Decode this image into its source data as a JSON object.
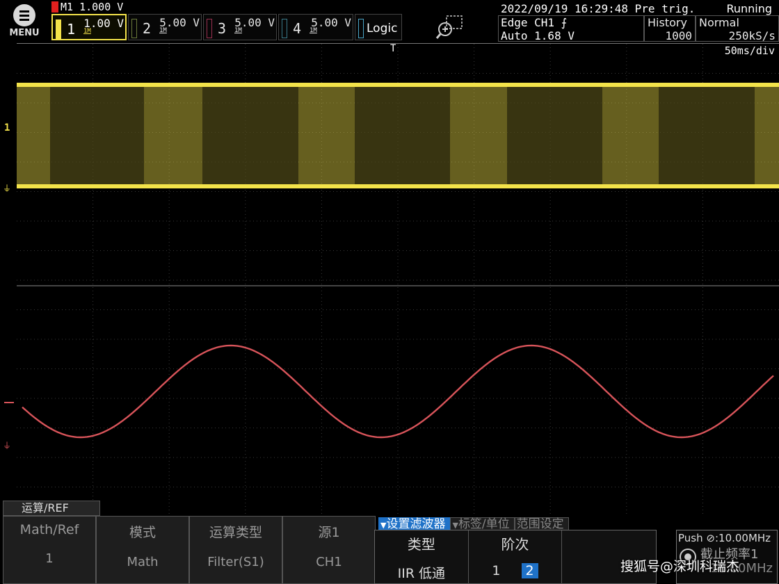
{
  "menu": {
    "label": "MENU"
  },
  "math_channel": {
    "label": "M1 1.000 V",
    "color": "#e0201e"
  },
  "channels": [
    {
      "num": "1",
      "value": "1.00 V",
      "impedance": "1M",
      "color": "#f3e34a",
      "active": true
    },
    {
      "num": "2",
      "value": "5.00 V",
      "impedance": "1M",
      "color": "#6a7a3a"
    },
    {
      "num": "3",
      "value": "5.00 V",
      "impedance": "1M",
      "color": "#9a3050"
    },
    {
      "num": "4",
      "value": "5.00 V",
      "impedance": "1M",
      "color": "#3a7a8a"
    }
  ],
  "logic": {
    "label": "Logic"
  },
  "status": {
    "datetime": "2022/09/19 16:29:48 Pre trig.",
    "run_state": "Running",
    "trigger_line1": "Edge CH1 ⨍",
    "trigger_line2": "Auto 1.68 V",
    "history_label": "History",
    "history_value": "1000",
    "mode_label": "Normal",
    "sample_rate": "250kS/s"
  },
  "display": {
    "timebase": "50ms/div",
    "trigger_marker": "T",
    "ch1_level_marker": "1",
    "ch1_color": "#f3e34a",
    "math_color": "#d8545a",
    "sine_cycles": 2.5
  },
  "bottom_menu": {
    "title": "运算/REF",
    "softkeys": [
      {
        "label": "Math/Ref",
        "value": "1"
      },
      {
        "label": "模式",
        "value": "Math"
      },
      {
        "label": "运算类型",
        "value": "Filter(S1)"
      },
      {
        "label": "源1",
        "value": "CH1"
      }
    ],
    "sub_tabs": [
      {
        "label": "设置滤波器",
        "active": true
      },
      {
        "label": "标签/单位",
        "active": false
      },
      {
        "label": "范围设定",
        "active": false
      }
    ],
    "subpanel": {
      "type_label": "类型",
      "type_value": "IIR 低通",
      "order_label": "阶次",
      "order_options": [
        "1",
        "2"
      ],
      "order_selected": "2"
    },
    "push": {
      "label": "Push",
      "value": ":10.00MHz",
      "cutoff_label": "截止频率1",
      "cutoff_value": "10.00MHz"
    }
  },
  "watermark": "搜狐号@深圳科瑞杰"
}
